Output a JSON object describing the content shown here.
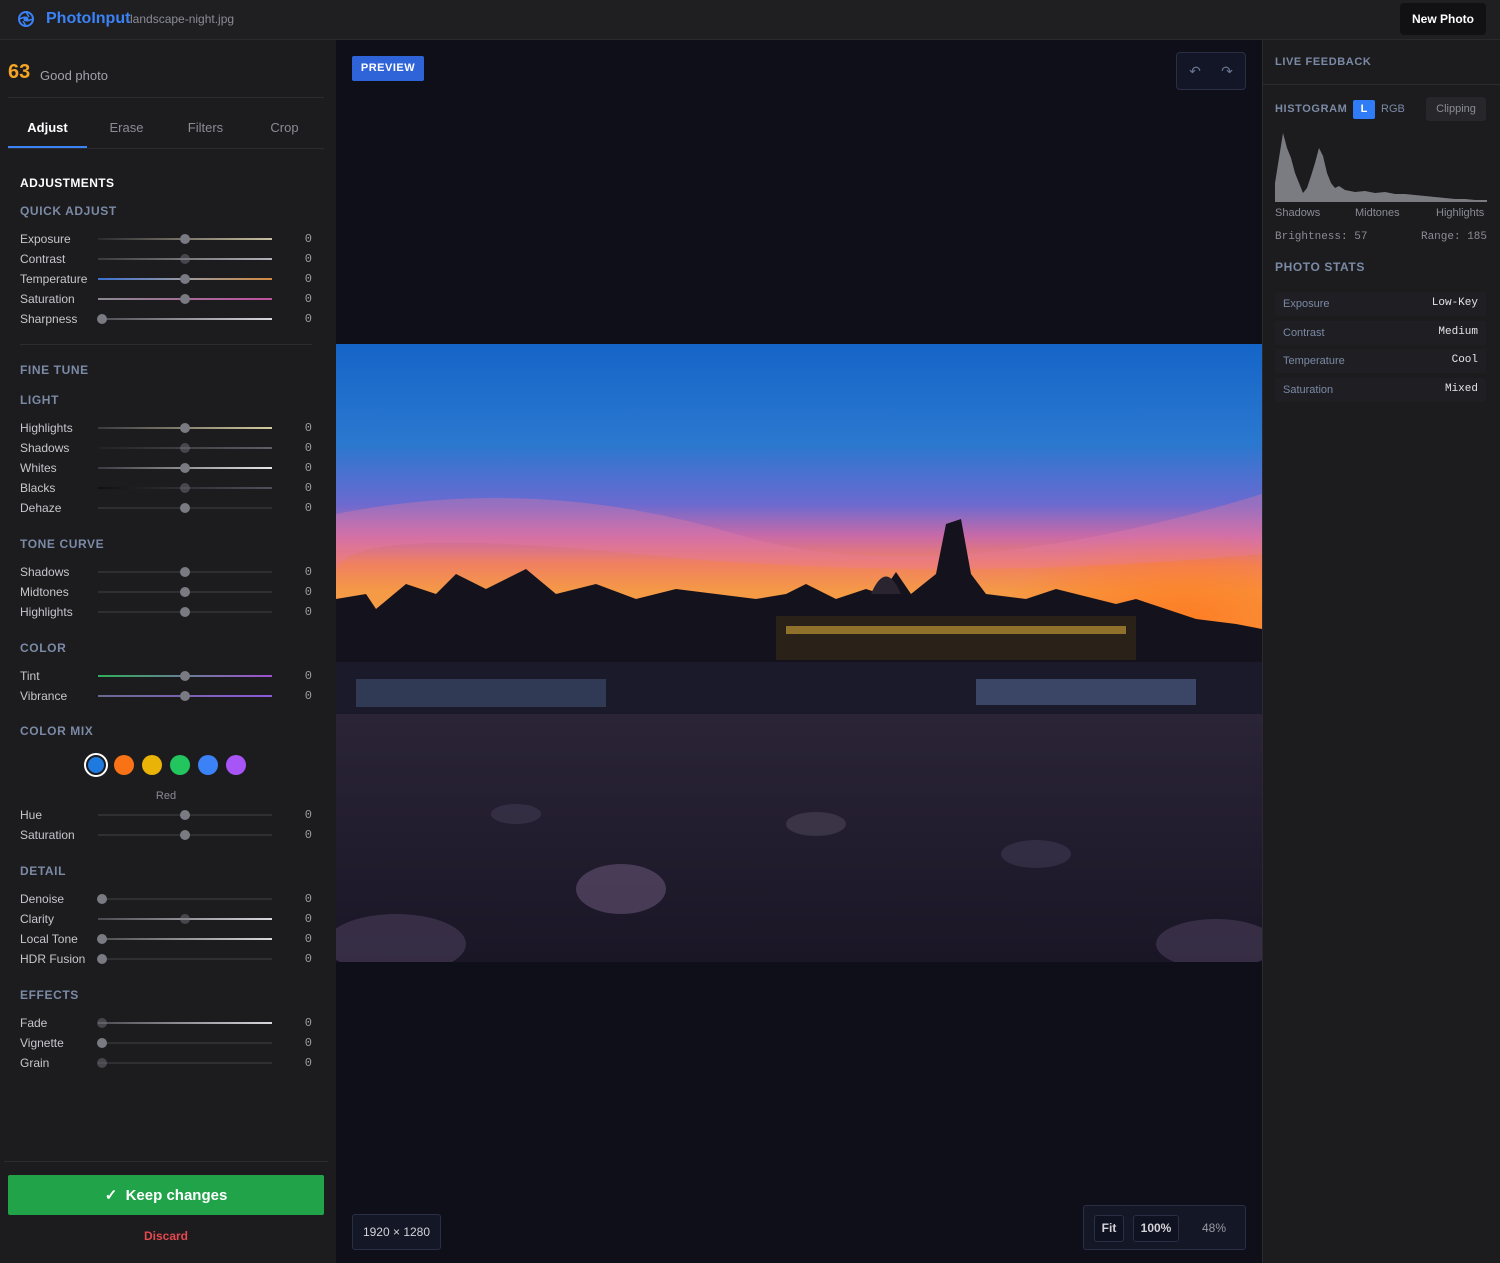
{
  "app": {
    "name": "PhotoInput",
    "filename": "landscape-night.jpg",
    "new_photo": "New Photo"
  },
  "score": {
    "value": "63",
    "label": "Good photo"
  },
  "tabs": [
    "Adjust",
    "Erase",
    "Filters",
    "Crop"
  ],
  "adjustments_title": "ADJUSTMENTS",
  "sections": {
    "quick": {
      "title": "QUICK ADJUST",
      "rows": [
        {
          "label": "Exposure",
          "value": "0",
          "level": 0.5
        },
        {
          "label": "Contrast",
          "value": "0",
          "level": 0.5
        },
        {
          "label": "Temperature",
          "value": "0",
          "level": 0.5
        },
        {
          "label": "Saturation",
          "value": "0",
          "level": 0.5
        },
        {
          "label": "Sharpness",
          "value": "0",
          "level": 0
        }
      ]
    },
    "fine_tune": "FINE TUNE",
    "light": {
      "title": "LIGHT",
      "rows": [
        {
          "label": "Highlights",
          "value": "0",
          "level": 0.5
        },
        {
          "label": "Shadows",
          "value": "0",
          "level": 0.5
        },
        {
          "label": "Whites",
          "value": "0",
          "level": 0.5
        },
        {
          "label": "Blacks",
          "value": "0",
          "level": 0.5
        },
        {
          "label": "Dehaze",
          "value": "0",
          "level": 0.5
        }
      ]
    },
    "tone": {
      "title": "TONE CURVE",
      "rows": [
        {
          "label": "Shadows",
          "value": "0",
          "level": 0.5
        },
        {
          "label": "Midtones",
          "value": "0",
          "level": 0.5
        },
        {
          "label": "Highlights",
          "value": "0",
          "level": 0.5
        }
      ]
    },
    "color": {
      "title": "COLOR",
      "rows": [
        {
          "label": "Tint",
          "value": "0",
          "level": 0.5
        },
        {
          "label": "Vibrance",
          "value": "0",
          "level": 0.5
        }
      ]
    },
    "color_mix": {
      "title": "COLOR MIX",
      "selected": "Red",
      "swatches": [
        "#1f7ae0",
        "#f97316",
        "#eab308",
        "#22c55e",
        "#3b82f6",
        "#a855f7"
      ],
      "rows": [
        {
          "label": "Hue",
          "value": "0",
          "level": 0.5
        },
        {
          "label": "Saturation",
          "value": "0",
          "level": 0.5
        }
      ]
    },
    "detail": {
      "title": "DETAIL",
      "rows": [
        {
          "label": "Denoise",
          "value": "0",
          "level": 0
        },
        {
          "label": "Clarity",
          "value": "0",
          "level": 0.5
        },
        {
          "label": "Local Tone",
          "value": "0",
          "level": 0
        },
        {
          "label": "HDR Fusion",
          "value": "0",
          "level": 0
        }
      ]
    },
    "effects": {
      "title": "EFFECTS",
      "rows": [
        {
          "label": "Fade",
          "value": "0",
          "level": 0
        },
        {
          "label": "Vignette",
          "value": "0",
          "level": 0
        },
        {
          "label": "Grain",
          "value": "0",
          "level": 0
        }
      ]
    }
  },
  "actions": {
    "keep": "Keep changes",
    "discard": "Discard"
  },
  "canvas": {
    "badge": "PREVIEW",
    "dimensions": "1920 × 1280",
    "fit": "Fit",
    "zoom_100": "100%",
    "zoom_current": "48%"
  },
  "feedback": {
    "title": "LIVE FEEDBACK",
    "histogram": {
      "title": "HISTOGRAM",
      "mode_l": "L",
      "mode_rgb": "RGB",
      "clipping": "Clipping",
      "labels": [
        "Shadows",
        "Midtones",
        "Highlights"
      ],
      "brightness": "Brightness: 57",
      "range": "Range: 185"
    },
    "stats_title": "PHOTO STATS",
    "stats": [
      {
        "key": "Exposure",
        "value": "Low-Key"
      },
      {
        "key": "Contrast",
        "value": "Medium"
      },
      {
        "key": "Temperature",
        "value": "Cool"
      },
      {
        "key": "Saturation",
        "value": "Mixed"
      }
    ]
  }
}
